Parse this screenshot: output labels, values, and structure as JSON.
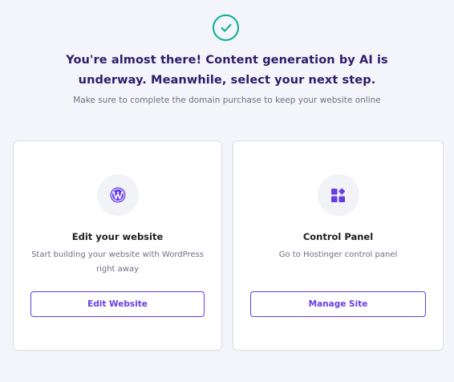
{
  "header": {
    "status_icon": "check-icon",
    "headline": "You're almost there! Content generation by AI is underway. Meanwhile, select your next step.",
    "subtitle": "Make sure to complete the domain purchase to keep your website online"
  },
  "cards": [
    {
      "icon": "wordpress-icon",
      "title": "Edit your website",
      "description": "Start building your website with WordPress right away",
      "button_label": "Edit Website"
    },
    {
      "icon": "control-panel-icon",
      "title": "Control Panel",
      "description": "Go to Hostinger control panel",
      "button_label": "Manage Site"
    }
  ],
  "colors": {
    "accent": "#673de6",
    "success": "#00b090",
    "background": "#f4f4fb",
    "heading": "#2f1c6a"
  }
}
